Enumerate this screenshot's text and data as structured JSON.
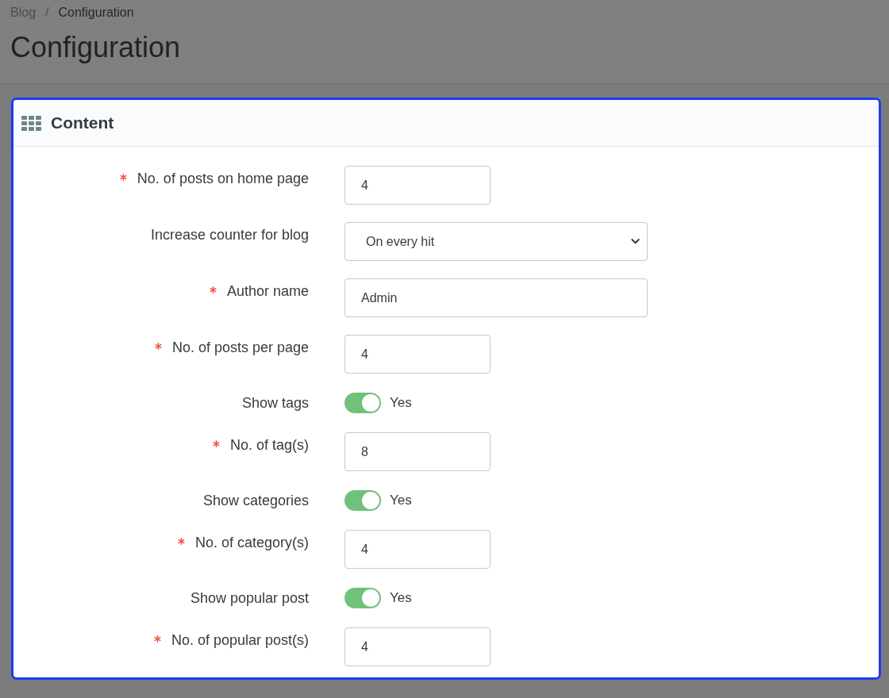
{
  "breadcrumb": {
    "items": [
      {
        "label": "Blog",
        "current": false
      },
      {
        "label": "Configuration",
        "current": true
      }
    ],
    "separator": "/"
  },
  "page_title": "Configuration",
  "panel": {
    "title": "Content",
    "highlighted": true,
    "fields": [
      {
        "kind": "number",
        "required": true,
        "label": "No. of posts on home page",
        "value": "4"
      },
      {
        "kind": "select",
        "required": false,
        "label": "Increase counter for blog",
        "value": "On every hit"
      },
      {
        "kind": "text",
        "required": true,
        "label": "Author name",
        "value": "Admin"
      },
      {
        "kind": "number",
        "required": true,
        "label": "No. of posts per page",
        "value": "4"
      },
      {
        "kind": "switch",
        "required": false,
        "label": "Show tags",
        "on": true,
        "state_label": "Yes"
      },
      {
        "kind": "number",
        "required": true,
        "label": "No. of tag(s)",
        "value": "8"
      },
      {
        "kind": "switch",
        "required": false,
        "label": "Show categories",
        "on": true,
        "state_label": "Yes"
      },
      {
        "kind": "number",
        "required": true,
        "label": "No. of category(s)",
        "value": "4"
      },
      {
        "kind": "switch",
        "required": false,
        "label": "Show popular post",
        "on": true,
        "state_label": "Yes"
      },
      {
        "kind": "number",
        "required": true,
        "label": "No. of popular post(s)",
        "value": "4"
      }
    ]
  }
}
